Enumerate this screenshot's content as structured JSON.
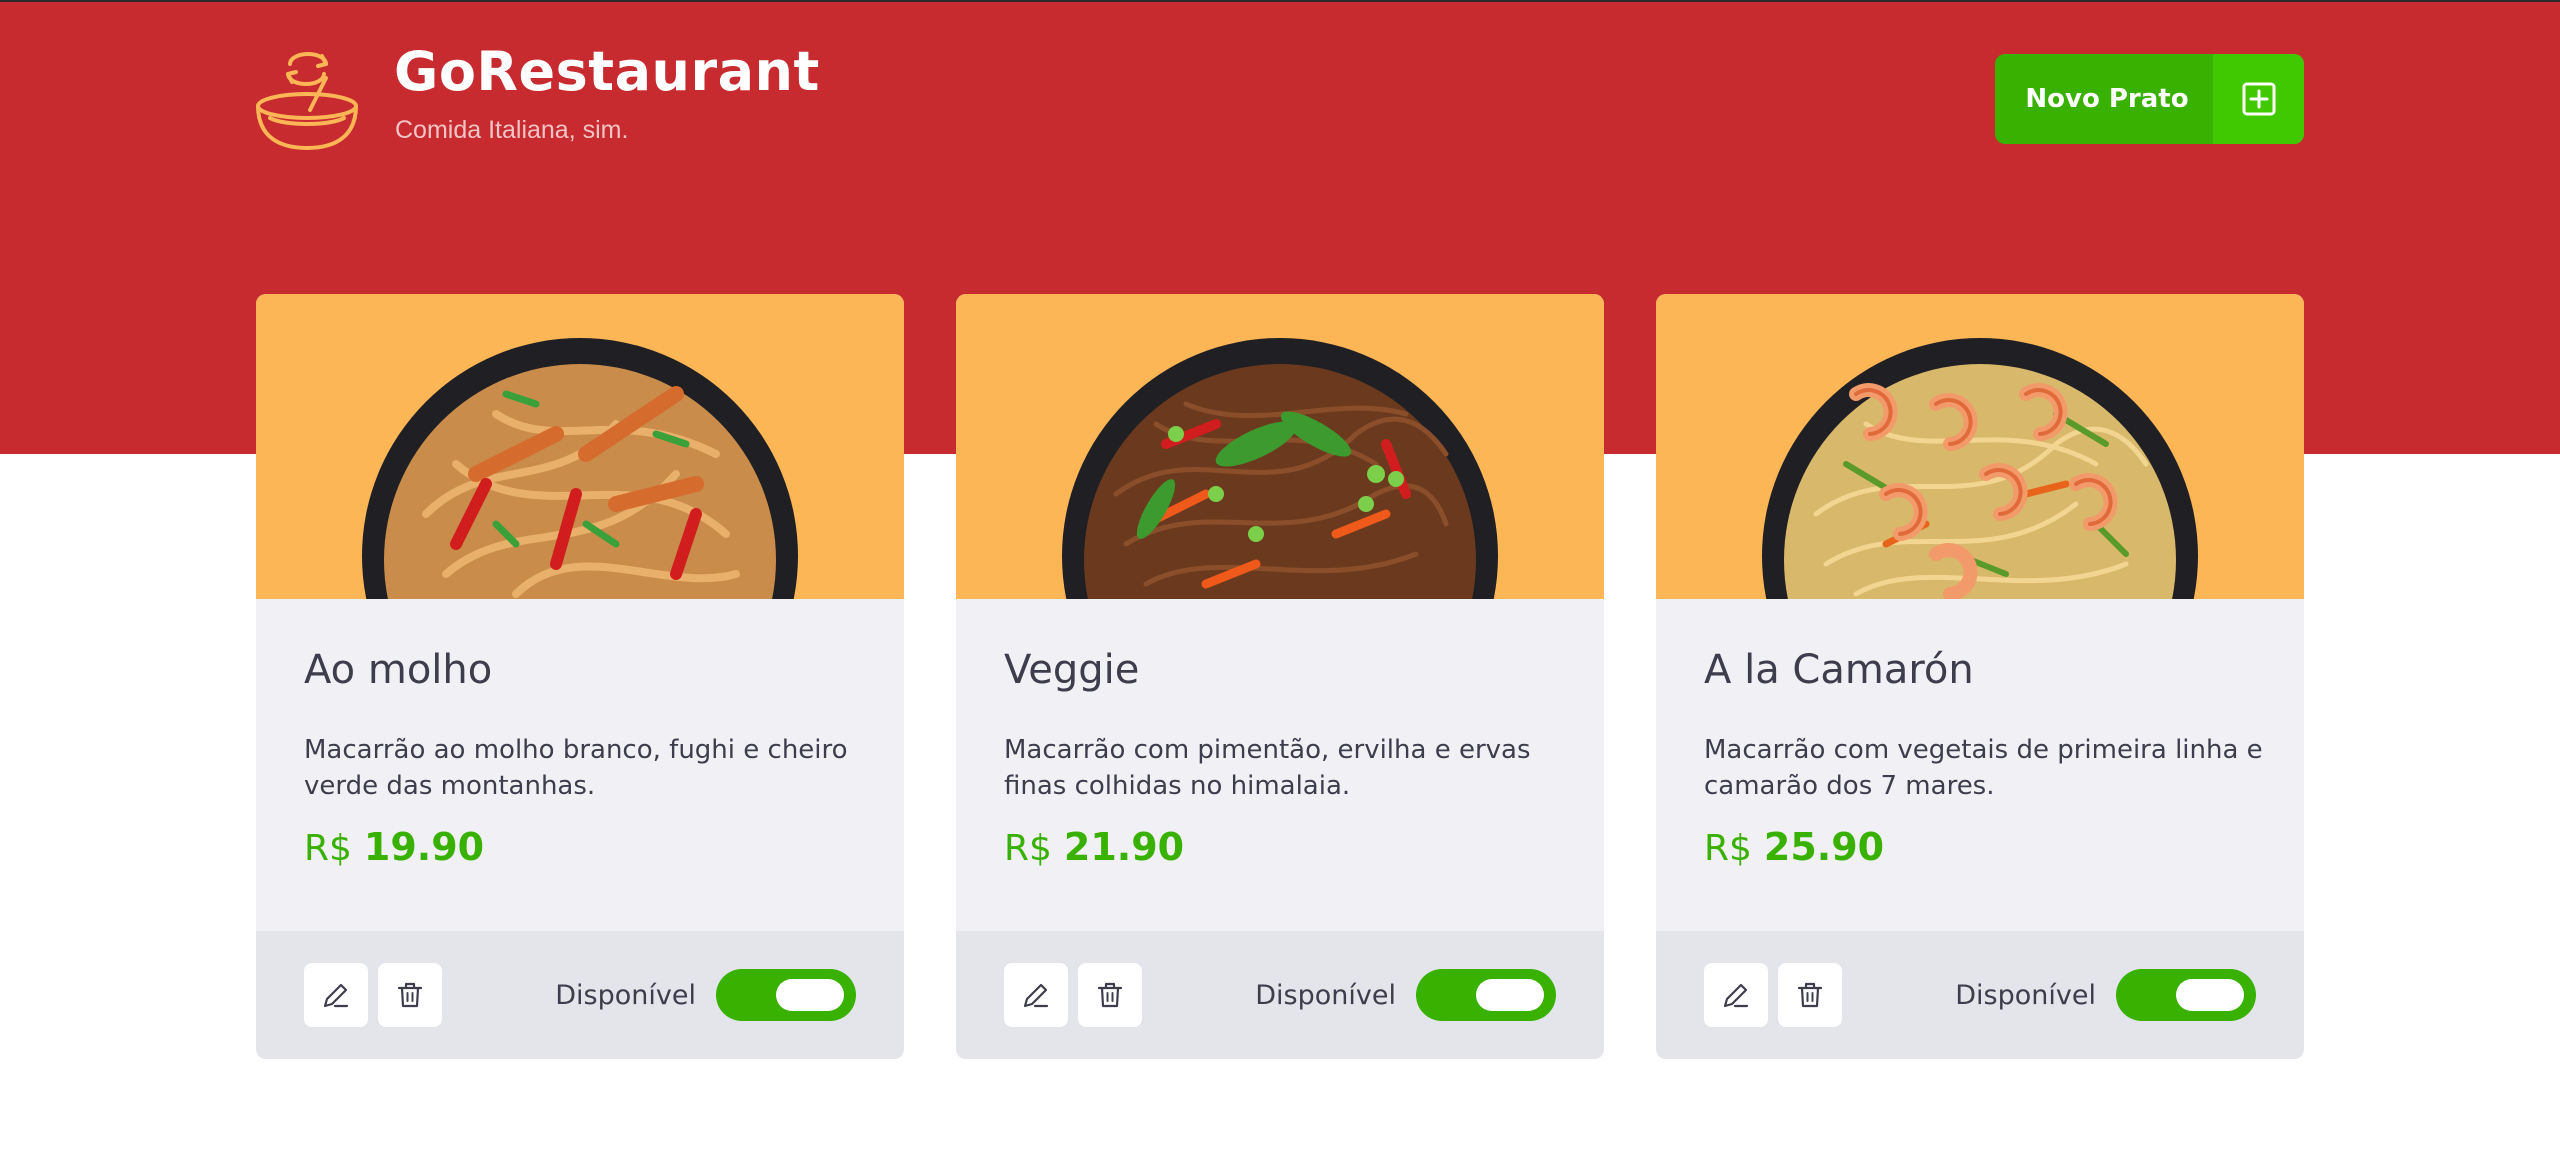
{
  "header": {
    "title": "GoRestaurant",
    "subtitle": "Comida Italiana, sim.",
    "new_button_label": "Novo Prato",
    "logo_icon": "bowl-icon",
    "add_icon": "plus-square-icon"
  },
  "colors": {
    "header_bg": "#c72a2f",
    "accent_green": "#39b100",
    "card_image_bg": "#fdb655",
    "card_body_bg": "#f0f0f5",
    "card_footer_bg": "#e4e4eb"
  },
  "foods": [
    {
      "name": "Ao molho",
      "description": "Macarrão ao molho branco, fughi e cheiro verde das montanhas.",
      "currency": "R$",
      "price": "19.90",
      "availability_label": "Disponível",
      "available": true,
      "edit_icon": "pencil-icon",
      "delete_icon": "trash-icon"
    },
    {
      "name": "Veggie",
      "description": "Macarrão com pimentão, ervilha e ervas finas colhidas no himalaia.",
      "currency": "R$",
      "price": "21.90",
      "availability_label": "Disponível",
      "available": true,
      "edit_icon": "pencil-icon",
      "delete_icon": "trash-icon"
    },
    {
      "name": "A la Camarón",
      "description": "Macarrão com vegetais de primeira linha e camarão dos 7 mares.",
      "currency": "R$",
      "price": "25.90",
      "availability_label": "Disponível",
      "available": true,
      "edit_icon": "pencil-icon",
      "delete_icon": "trash-icon"
    }
  ]
}
